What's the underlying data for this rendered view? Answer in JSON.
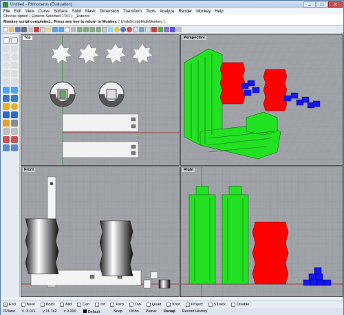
{
  "window": {
    "title": "Untitled - Rhinoceros (Evaluation)"
  },
  "menu": [
    "File",
    "Edit",
    "View",
    "Curve",
    "Surface",
    "Solid",
    "Mesh",
    "Dimension",
    "Transform",
    "Tools",
    "Analyze",
    "Render",
    "Monkey",
    "Help"
  ],
  "command_history": {
    "line1": "Choose option ( Extents  Selected  1To1 ): _Extents",
    "line2_bold": "Monkey script completed...     Press any key to return to Monkey.",
    "line2_rest": " ( UndoScript  HideMonkey ):"
  },
  "viewports": {
    "top": "Top",
    "perspective": "Perspective",
    "front": "Front",
    "right": "Right"
  },
  "osnaps": [
    {
      "label": "End",
      "checked": true
    },
    {
      "label": "Near",
      "checked": false
    },
    {
      "label": "Point",
      "checked": false
    },
    {
      "label": "Mid",
      "checked": false
    },
    {
      "label": "Cen",
      "checked": false
    },
    {
      "label": "Int",
      "checked": false
    },
    {
      "label": "Perp",
      "checked": false
    },
    {
      "label": "Tan",
      "checked": false
    },
    {
      "label": "Quad",
      "checked": false
    },
    {
      "label": "Knot",
      "checked": false
    },
    {
      "label": "Project",
      "checked": false
    },
    {
      "label": "STrack",
      "checked": false
    },
    {
      "label": "Disable",
      "checked": false
    }
  ],
  "status": {
    "cplane": "CPlane",
    "x": "x -3.071",
    "y": "y 11.742",
    "z": "z 0.000",
    "layer": "Default",
    "toggles": [
      "Snap",
      "Ortho",
      "Planar",
      "Osnap",
      "Record History"
    ]
  },
  "colors": {
    "green": "#22e022",
    "red": "#ff0000",
    "blue": "#0000ff",
    "viewport_bg": "#9fa3a8"
  }
}
